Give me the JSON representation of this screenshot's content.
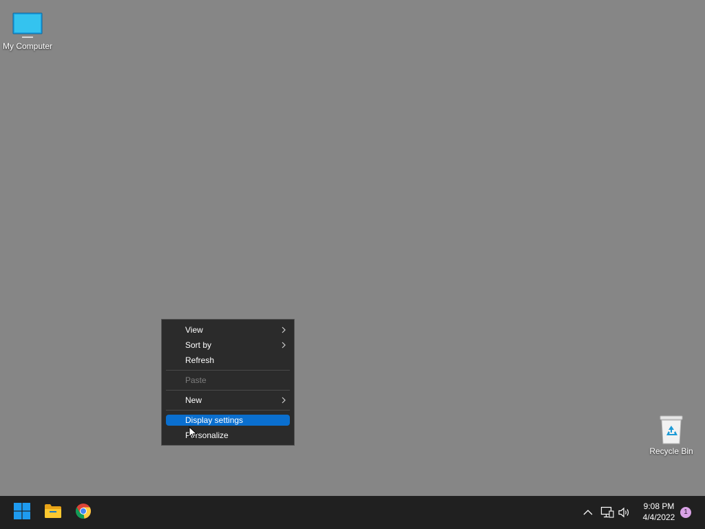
{
  "desktop": {
    "background_color": "#868686",
    "icons": [
      {
        "label": "My Computer",
        "icon": "monitor-icon"
      },
      {
        "label": "Recycle Bin",
        "icon": "recycle-bin-icon"
      }
    ]
  },
  "context_menu": {
    "items": [
      {
        "label": "View",
        "has_submenu": true,
        "enabled": true
      },
      {
        "label": "Sort by",
        "has_submenu": true,
        "enabled": true
      },
      {
        "label": "Refresh",
        "has_submenu": false,
        "enabled": true
      },
      {
        "label": "Paste",
        "has_submenu": false,
        "enabled": false
      },
      {
        "label": "New",
        "has_submenu": true,
        "enabled": true
      },
      {
        "label": "Display settings",
        "has_submenu": false,
        "enabled": true,
        "highlighted": true
      },
      {
        "label": "Personalize",
        "has_submenu": false,
        "enabled": true
      }
    ],
    "highlight_color": "#0a6fcf"
  },
  "taskbar": {
    "background_color": "#202020",
    "pinned": [
      {
        "name": "Start",
        "icon": "windows-logo-icon"
      },
      {
        "name": "File Explorer",
        "icon": "folder-icon"
      },
      {
        "name": "Google Chrome",
        "icon": "chrome-icon"
      }
    ],
    "tray": {
      "icons": [
        "chevron-up-icon",
        "network-icon",
        "volume-icon"
      ],
      "time": "9:08 PM",
      "date": "4/4/2022",
      "notification_count": "1"
    }
  }
}
